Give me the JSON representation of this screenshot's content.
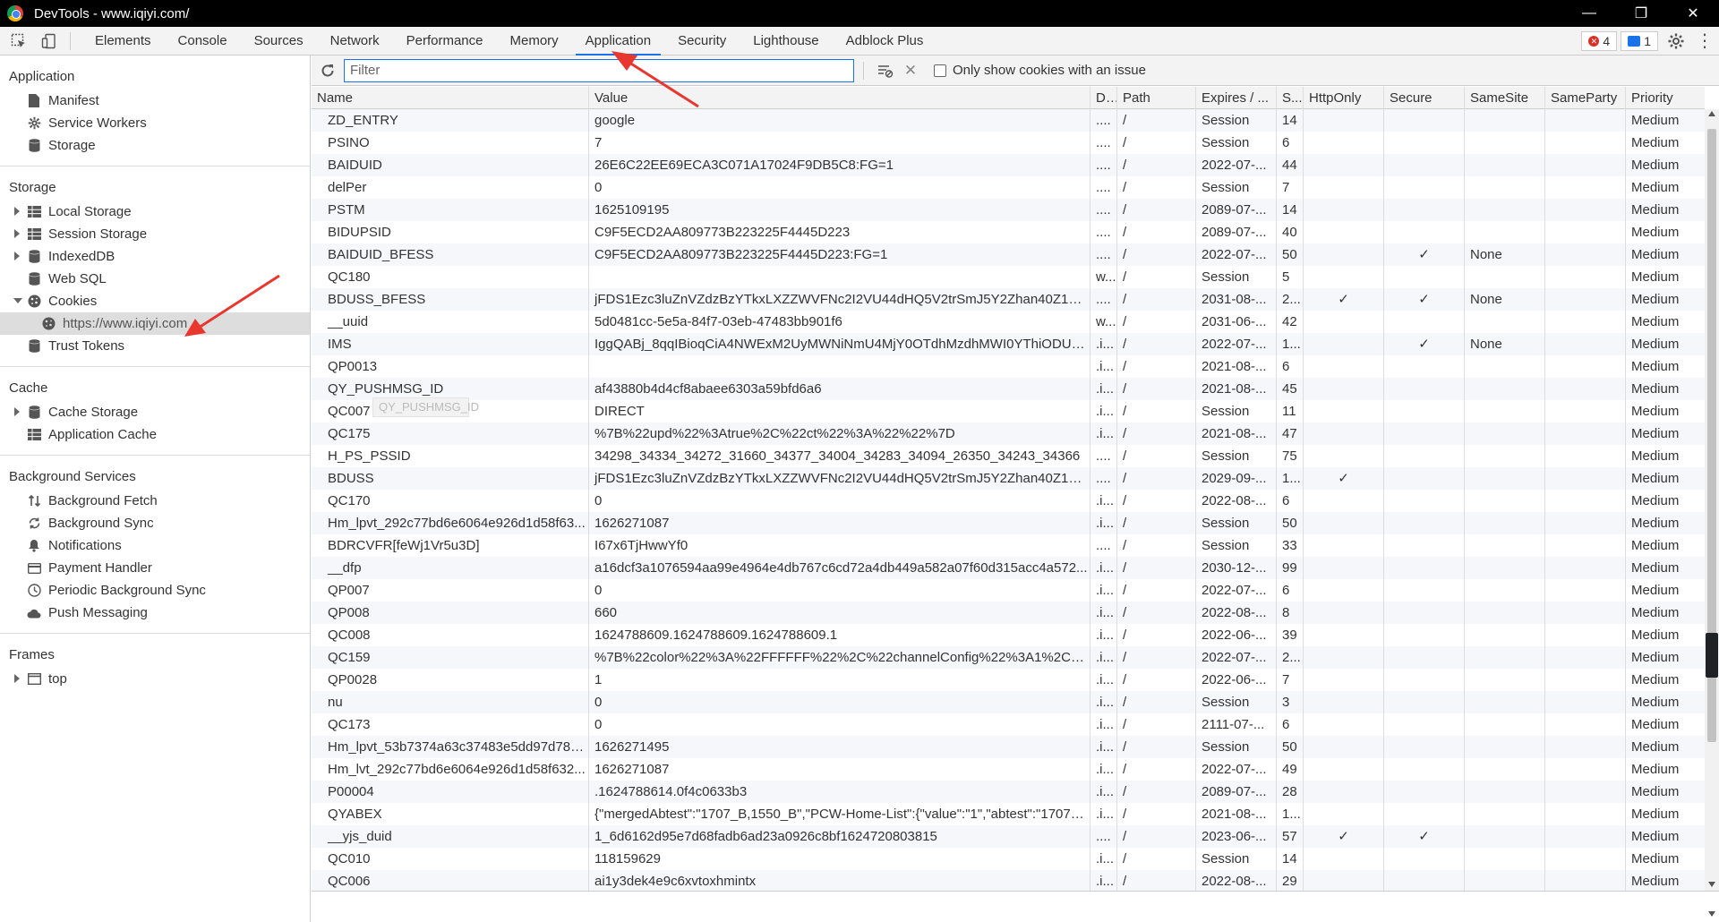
{
  "window": {
    "title": "DevTools - www.iqiyi.com/",
    "controls": [
      "—",
      "❐",
      "✕"
    ]
  },
  "tabs": [
    {
      "label": "Elements"
    },
    {
      "label": "Console"
    },
    {
      "label": "Sources"
    },
    {
      "label": "Network"
    },
    {
      "label": "Performance"
    },
    {
      "label": "Memory"
    },
    {
      "label": "Application",
      "active": true
    },
    {
      "label": "Security"
    },
    {
      "label": "Lighthouse"
    },
    {
      "label": "Adblock Plus"
    }
  ],
  "badges": {
    "errors": "4",
    "messages": "1"
  },
  "sidebar": {
    "application": {
      "heading": "Application",
      "items": [
        "Manifest",
        "Service Workers",
        "Storage"
      ]
    },
    "storage": {
      "heading": "Storage",
      "items": [
        "Local Storage",
        "Session Storage",
        "IndexedDB",
        "Web SQL",
        "Cookies",
        "https://www.iqiyi.com",
        "Trust Tokens"
      ]
    },
    "cache": {
      "heading": "Cache",
      "items": [
        "Cache Storage",
        "Application Cache"
      ]
    },
    "background": {
      "heading": "Background Services",
      "items": [
        "Background Fetch",
        "Background Sync",
        "Notifications",
        "Payment Handler",
        "Periodic Background Sync",
        "Push Messaging"
      ]
    },
    "frames": {
      "heading": "Frames",
      "items": [
        "top"
      ]
    }
  },
  "toolbar": {
    "filter_placeholder": "Filter",
    "only_issue_label": "Only show cookies with an issue"
  },
  "table": {
    "columns": [
      "Name",
      "Value",
      "D...",
      "Path",
      "Expires / ...",
      "S...",
      "HttpOnly",
      "Secure",
      "SameSite",
      "SameParty",
      "Priority"
    ],
    "rows": [
      [
        "ZD_ENTRY",
        "google",
        "....",
        "/",
        "Session",
        "14",
        "",
        "",
        "",
        "",
        "Medium"
      ],
      [
        "PSINO",
        "7",
        "....",
        "/",
        "Session",
        "6",
        "",
        "",
        "",
        "",
        "Medium"
      ],
      [
        "BAIDUID",
        "26E6C22EE69ECA3C071A17024F9DB5C8:FG=1",
        "....",
        "/",
        "2022-07-...",
        "44",
        "",
        "",
        "",
        "",
        "Medium"
      ],
      [
        "delPer",
        "0",
        "....",
        "/",
        "Session",
        "7",
        "",
        "",
        "",
        "",
        "Medium"
      ],
      [
        "PSTM",
        "1625109195",
        "....",
        "/",
        "2089-07-...",
        "14",
        "",
        "",
        "",
        "",
        "Medium"
      ],
      [
        "BIDUPSID",
        "C9F5ECD2AA809773B223225F4445D223",
        "....",
        "/",
        "2089-07-...",
        "40",
        "",
        "",
        "",
        "",
        "Medium"
      ],
      [
        "BAIDUID_BFESS",
        "C9F5ECD2AA809773B223225F4445D223:FG=1",
        "....",
        "/",
        "2022-07-...",
        "50",
        "",
        "✓",
        "None",
        "",
        "Medium"
      ],
      [
        "QC180",
        "",
        "w...",
        "/",
        "Session",
        "5",
        "",
        "",
        "",
        "",
        "Medium"
      ],
      [
        "BDUSS_BFESS",
        "jFDS1Ezc3luZnVZdzBzYTkxLXZZWVFNc2I2VU44dHQ5V2trSmJ5Y2Zhan40Z1ZoSU...",
        "....",
        "/",
        "2031-08-...",
        "2...",
        "✓",
        "✓",
        "None",
        "",
        "Medium"
      ],
      [
        "__uuid",
        "5d0481cc-5e5a-84f7-03eb-47483bb901f6",
        "w...",
        "/",
        "2031-06-...",
        "42",
        "",
        "",
        "",
        "",
        "Medium"
      ],
      [
        "IMS",
        "IggQABj_8qqIBioqCiA4NWExM2UyMWNiNmU4MjY0OTdhMzdhMWI0YThiODUw...",
        ".i...",
        "/",
        "2022-07-...",
        "1...",
        "",
        "✓",
        "None",
        "",
        "Medium"
      ],
      [
        "QP0013",
        "",
        ".i...",
        "/",
        "2021-08-...",
        "6",
        "",
        "",
        "",
        "",
        "Medium"
      ],
      [
        "QY_PUSHMSG_ID",
        "af43880b4d4cf8abaee6303a59bfd6a6",
        ".i...",
        "/",
        "2021-08-...",
        "45",
        "",
        "",
        "",
        "",
        "Medium"
      ],
      [
        "QC007",
        "DIRECT",
        ".i...",
        "/",
        "Session",
        "11",
        "",
        "",
        "",
        "",
        "Medium"
      ],
      [
        "QC175",
        "%7B%22upd%22%3Atrue%2C%22ct%22%3A%22%22%7D",
        ".i...",
        "/",
        "2021-08-...",
        "47",
        "",
        "",
        "",
        "",
        "Medium"
      ],
      [
        "H_PS_PSSID",
        "34298_34334_34272_31660_34377_34004_34283_34094_26350_34243_34366",
        "....",
        "/",
        "Session",
        "75",
        "",
        "",
        "",
        "",
        "Medium"
      ],
      [
        "BDUSS",
        "jFDS1Ezc3luZnVZdzBzYTkxLXZZWVFNc2I2VU44dHQ5V2trSmJ5Y2Zhan40Z1ZoSU...",
        "....",
        "/",
        "2029-09-...",
        "1...",
        "✓",
        "",
        "",
        "",
        "Medium"
      ],
      [
        "QC170",
        "0",
        ".i...",
        "/",
        "2022-08-...",
        "6",
        "",
        "",
        "",
        "",
        "Medium"
      ],
      [
        "Hm_lpvt_292c77bd6e6064e926d1d58f63...",
        "1626271087",
        ".i...",
        "/",
        "Session",
        "50",
        "",
        "",
        "",
        "",
        "Medium"
      ],
      [
        "BDRCVFR[feWj1Vr5u3D]",
        "I67x6TjHwwYf0",
        "....",
        "/",
        "Session",
        "33",
        "",
        "",
        "",
        "",
        "Medium"
      ],
      [
        "__dfp",
        "a16dcf3a1076594aa99e4964e4db767c6cd72a4db449a582a07f60d315acc4a572...",
        ".i...",
        "/",
        "2030-12-...",
        "99",
        "",
        "",
        "",
        "",
        "Medium"
      ],
      [
        "QP007",
        "0",
        ".i...",
        "/",
        "2022-07-...",
        "6",
        "",
        "",
        "",
        "",
        "Medium"
      ],
      [
        "QP008",
        "660",
        ".i...",
        "/",
        "2022-08-...",
        "8",
        "",
        "",
        "",
        "",
        "Medium"
      ],
      [
        "QC008",
        "1624788609.1624788609.1624788609.1",
        ".i...",
        "/",
        "2022-06-...",
        "39",
        "",
        "",
        "",
        "",
        "Medium"
      ],
      [
        "QC159",
        "%7B%22color%22%3A%22FFFFFF%22%2C%22channelConfig%22%3A1%2C%22...",
        ".i...",
        "/",
        "2022-07-...",
        "2...",
        "",
        "",
        "",
        "",
        "Medium"
      ],
      [
        "QP0028",
        "1",
        ".i...",
        "/",
        "2022-06-...",
        "7",
        "",
        "",
        "",
        "",
        "Medium"
      ],
      [
        "nu",
        "0",
        ".i...",
        "/",
        "Session",
        "3",
        "",
        "",
        "",
        "",
        "Medium"
      ],
      [
        "QC173",
        "0",
        ".i...",
        "/",
        "2111-07-...",
        "6",
        "",
        "",
        "",
        "",
        "Medium"
      ],
      [
        "Hm_lpvt_53b7374a63c37483e5dd97d78d...",
        "1626271495",
        ".i...",
        "/",
        "Session",
        "50",
        "",
        "",
        "",
        "",
        "Medium"
      ],
      [
        "Hm_lvt_292c77bd6e6064e926d1d58f632...",
        "1626271087",
        ".i...",
        "/",
        "2022-07-...",
        "49",
        "",
        "",
        "",
        "",
        "Medium"
      ],
      [
        "P00004",
        ".1624788614.0f4c0633b3",
        ".i...",
        "/",
        "2089-07-...",
        "28",
        "",
        "",
        "",
        "",
        "Medium"
      ],
      [
        "QYABEX",
        "{\"mergedAbtest\":\"1707_B,1550_B\",\"PCW-Home-List\":{\"value\":\"1\",\"abtest\":\"1707_B...",
        ".i...",
        "/",
        "2021-08-...",
        "1...",
        "",
        "",
        "",
        "",
        "Medium"
      ],
      [
        "__yjs_duid",
        "1_6d6162d95e7d68fadb6ad23a0926c8bf1624720803815",
        "....",
        "/",
        "2023-06-...",
        "57",
        "✓",
        "✓",
        "",
        "",
        "Medium"
      ],
      [
        "QC010",
        "118159629",
        ".i...",
        "/",
        "Session",
        "14",
        "",
        "",
        "",
        "",
        "Medium"
      ],
      [
        "QC006",
        "ai1y3dek4e9c6xvtoxhmintx",
        ".i...",
        "/",
        "2022-08-...",
        "29",
        "",
        "",
        "",
        "",
        "Medium"
      ]
    ]
  },
  "tooltip_ghost": "QY_PUSHMSG_ID",
  "colors": {
    "accent": "#1a73e8",
    "annotation": "#e8372f"
  }
}
